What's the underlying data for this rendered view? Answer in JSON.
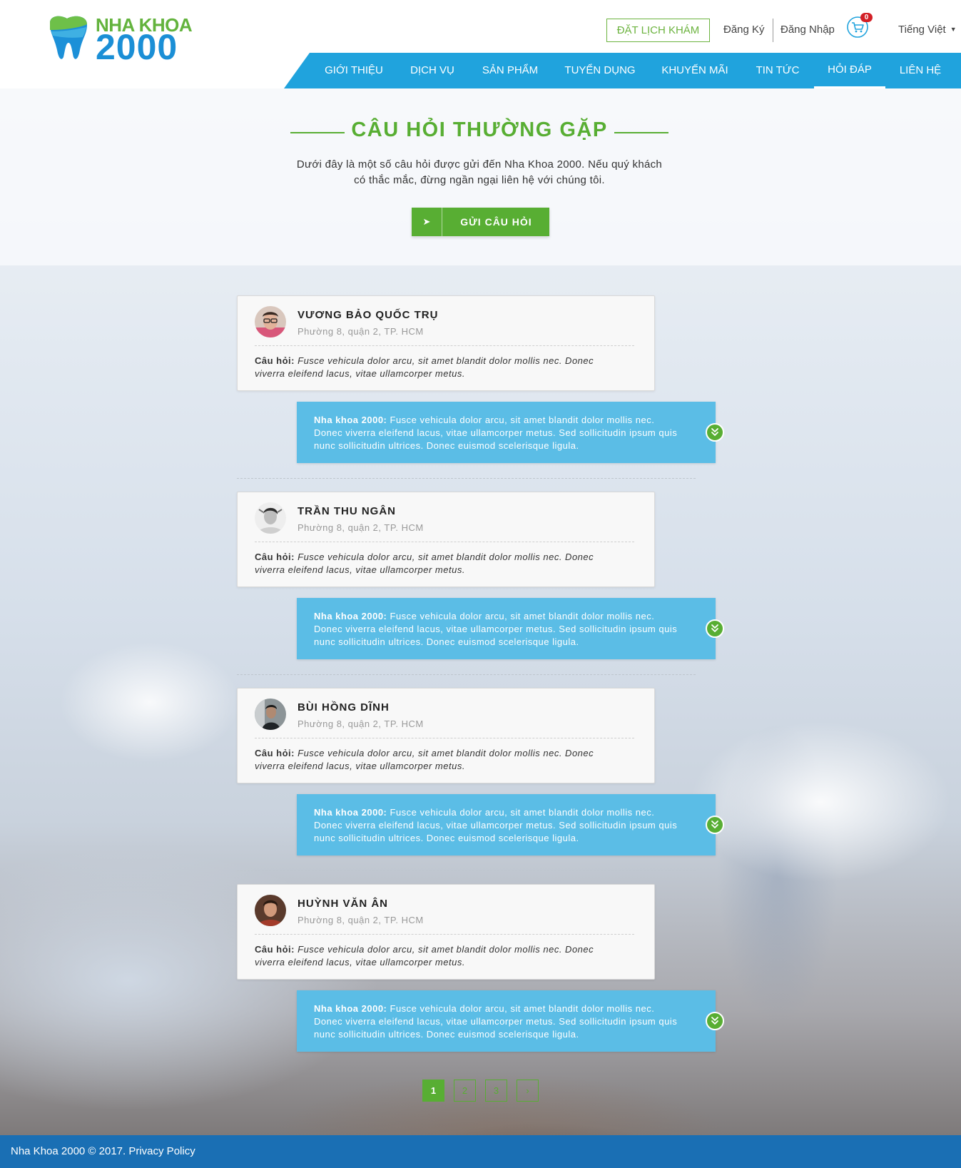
{
  "brand": {
    "name_line1": "NHA KHOA",
    "name_line2": "2000"
  },
  "header": {
    "booking_label": "ĐẶT LỊCH KHÁM",
    "register_label": "Đăng Ký",
    "login_label": "Đăng Nhập",
    "cart_count": "0",
    "language_label": "Tiếng Việt"
  },
  "nav": {
    "items": [
      {
        "label": "GIỚI THIỆU"
      },
      {
        "label": "DỊCH VỤ"
      },
      {
        "label": "SẢN PHẨM"
      },
      {
        "label": "TUYỂN DỤNG"
      },
      {
        "label": "KHUYẾN MÃI"
      },
      {
        "label": "TIN TỨC"
      },
      {
        "label": "HỎI ĐÁP"
      },
      {
        "label": "LIÊN HỆ"
      }
    ],
    "active_item": "HỎI ĐÁP"
  },
  "intro": {
    "title": "CÂU HỎI THƯỜNG GẶP",
    "text_line1": "Dưới đây là một số câu hỏi được gửi đến Nha Khoa 2000. Nếu quý khách",
    "text_line2": "có thắc mắc, đừng ngần ngại liên hệ với chúng tôi.",
    "ask_button_label": "GỬI CÂU HỎI"
  },
  "faq": {
    "question_prefix": "Câu hỏi:",
    "answer_prefix": "Nha khoa 2000:",
    "items": [
      {
        "name": "VƯƠNG BẢO QUỐC TRỤ",
        "address": "Phường 8, quận 2, TP. HCM",
        "question": "Fusce vehicula dolor arcu, sit amet blandit dolor mollis nec. Donec viverra eleifend lacus, vitae ullamcorper metus.",
        "answer": "Fusce vehicula dolor arcu, sit amet blandit dolor mollis nec. Donec viverra eleifend lacus, vitae ullamcorper metus. Sed sollicitudin ipsum quis nunc sollicitudin ultrices. Donec euismod scelerisque ligula."
      },
      {
        "name": "TRẦN THU NGÂN",
        "address": "Phường 8, quận 2, TP. HCM",
        "question": "Fusce vehicula dolor arcu, sit amet blandit dolor mollis nec. Donec viverra eleifend lacus, vitae ullamcorper metus.",
        "answer": "Fusce vehicula dolor arcu, sit amet blandit dolor mollis nec. Donec viverra eleifend lacus, vitae ullamcorper metus. Sed sollicitudin ipsum quis nunc sollicitudin ultrices. Donec euismod scelerisque ligula."
      },
      {
        "name": "BÙI HỒNG DĨNH",
        "address": "Phường 8, quận 2, TP. HCM",
        "question": "Fusce vehicula dolor arcu, sit amet blandit dolor mollis nec. Donec viverra eleifend lacus, vitae ullamcorper metus.",
        "answer": "Fusce vehicula dolor arcu, sit amet blandit dolor mollis nec. Donec viverra eleifend lacus, vitae ullamcorper metus. Sed sollicitudin ipsum quis nunc sollicitudin ultrices. Donec euismod scelerisque ligula."
      },
      {
        "name": "HUỲNH VĂN ÂN",
        "address": "Phường 8, quận 2, TP. HCM",
        "question": "Fusce vehicula dolor arcu, sit amet blandit dolor mollis nec. Donec viverra eleifend lacus, vitae ullamcorper metus.",
        "answer": "Fusce vehicula dolor arcu, sit amet blandit dolor mollis nec. Donec viverra eleifend lacus, vitae ullamcorper metus. Sed sollicitudin ipsum quis nunc sollicitudin ultrices. Donec euismod scelerisque ligula."
      }
    ]
  },
  "pagination": {
    "pages": [
      "1",
      "2",
      "3",
      "›"
    ],
    "current": "1"
  },
  "footer": {
    "text": "Nha Khoa 2000 © 2017. Privacy Policy"
  },
  "colors": {
    "green": "#58ae33",
    "blue_nav": "#20a3dd",
    "blue_answer": "#5bbde6",
    "footer": "#1a6fb4",
    "cart_badge": "#d31f26"
  },
  "icons": {
    "cart": "shopping-cart-icon",
    "send": "send-icon",
    "expand": "chevron-double-down-icon",
    "language_caret": "caret-down-icon"
  }
}
